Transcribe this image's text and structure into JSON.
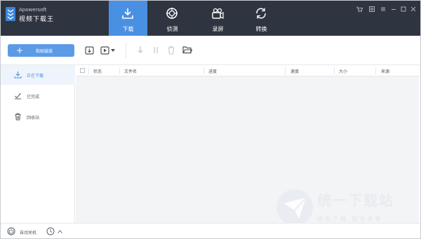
{
  "app": {
    "brand_en": "Apowersoft",
    "brand_cn": "视频下载王"
  },
  "nav": {
    "tabs": [
      {
        "label": "下载",
        "icon": "download-icon",
        "active": true
      },
      {
        "label": "侦测",
        "icon": "detect-icon",
        "active": false
      },
      {
        "label": "录屏",
        "icon": "record-icon",
        "active": false
      },
      {
        "label": "转换",
        "icon": "convert-icon",
        "active": false
      }
    ]
  },
  "window_controls": [
    "cart-icon",
    "settings-icon",
    "menu-icon",
    "minimize-icon",
    "maximize-icon",
    "close-icon"
  ],
  "toolbar": {
    "paste_label": "粘贴链接",
    "icons": [
      "copy-link-icon",
      "play-dropdown-icon",
      "start-icon",
      "pause-icon",
      "delete-icon",
      "open-folder-icon"
    ]
  },
  "sidebar": {
    "items": [
      {
        "label": "正在下载",
        "icon": "download-icon",
        "active": true
      },
      {
        "label": "已完成",
        "icon": "completed-icon",
        "active": false
      },
      {
        "label": "回收站",
        "icon": "trash-icon",
        "active": false
      }
    ]
  },
  "table": {
    "columns": [
      "状态",
      "文件名",
      "进度",
      "速度",
      "大小",
      "来源"
    ],
    "rows": []
  },
  "status": {
    "auto_label": "自动关机"
  },
  "watermark": {
    "title": "统一下载站",
    "subtitle": "绿色下载  服务未来"
  },
  "colors": {
    "titlebar": "#2f3441",
    "accent": "#4a90e2",
    "button": "#5b9be6"
  }
}
